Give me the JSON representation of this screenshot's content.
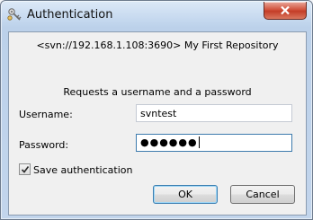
{
  "window": {
    "title": "Authentication",
    "close_label": "Close"
  },
  "dialog": {
    "repository": "<svn://192.168.1.108:3690> My First Repository",
    "prompt": "Requests a username and a password",
    "username_label": "Username:",
    "username_value": "svntest",
    "password_label": "Password:",
    "password_masked": "●●●●●●",
    "save_auth_label": "Save authentication",
    "save_auth_checked": true,
    "ok_label": "OK",
    "cancel_label": "Cancel"
  },
  "icons": {
    "title": "keys-icon",
    "close": "close-icon",
    "check": "checkmark-icon"
  },
  "colors": {
    "frame": "#c2d5ec",
    "close_button": "#c43d27",
    "focus_border": "#3d7bad"
  }
}
